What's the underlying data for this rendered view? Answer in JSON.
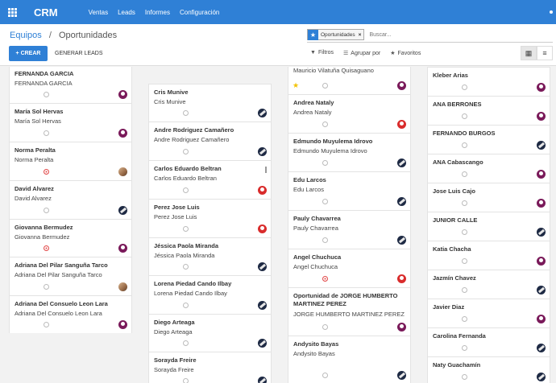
{
  "navbar": {
    "brand": "CRM",
    "menu": [
      "Ventas",
      "Leads",
      "Informes",
      "Configuración"
    ]
  },
  "breadcrumb": {
    "parent": "Equipos",
    "separator": "/",
    "current": "Oportunidades"
  },
  "buttons": {
    "create": "+ CREAR",
    "generate": "GENERAR LEADS"
  },
  "search": {
    "facet": "Oportunidades",
    "placeholder": "Buscar..."
  },
  "filters": {
    "filters": "Filtros",
    "group_by": "Agrupar por",
    "favorites": "Favoritos"
  },
  "columns": [
    {
      "cards": [
        {
          "title": "FERNANDA GARCIA",
          "sub": "FERNANDA GARCIA",
          "status": "grey",
          "avatar": "purple"
        },
        {
          "title": "María Sol Hervas",
          "sub": "María Sol Hervas",
          "status": "grey",
          "avatar": "purple"
        },
        {
          "title": "Norma Peralta",
          "sub": "Norma Peralta",
          "status": "red",
          "avatar": "photo"
        },
        {
          "title": "David Alvarez",
          "sub": "David Alvarez",
          "status": "grey",
          "avatar": "dark"
        },
        {
          "title": "Giovanna Bermudez",
          "sub": "Giovanna Bermudez",
          "status": "red",
          "avatar": "purple"
        },
        {
          "title": "Adriana Del Pilar Sanguña Tarco",
          "sub": "Adriana Del Pilar Sanguña Tarco",
          "status": "grey",
          "avatar": "photo"
        },
        {
          "title": "Adriana Del Consuelo Leon Lara",
          "sub": "Adriana Del Consuelo Leon Lara",
          "status": "grey",
          "avatar": "purple"
        }
      ]
    },
    {
      "cards": [
        {
          "title": "Cris Munive",
          "sub": "Cris Munive",
          "status": "grey",
          "avatar": "dark"
        },
        {
          "title": "Andre Rodriguez Camañero",
          "sub": "Andre Rodriguez Camañero",
          "status": "grey",
          "avatar": "dark"
        },
        {
          "title": "Carlos Eduardo Beltran",
          "sub": "Carlos Eduardo Beltran",
          "status": "grey",
          "avatar": "red"
        },
        {
          "title": "Perez Jose Luis",
          "sub": "Perez Jose Luis",
          "status": "grey",
          "avatar": "red"
        },
        {
          "title": "Jéssica Paola Miranda",
          "sub": "Jéssica Paola Miranda",
          "status": "grey",
          "avatar": "dark"
        },
        {
          "title": "Lorena Piedad Cando Ilbay",
          "sub": "Lorena Piedad Cando Ilbay",
          "status": "grey",
          "avatar": "dark"
        },
        {
          "title": "Diego Arteaga",
          "sub": "Diego Arteaga",
          "status": "grey",
          "avatar": "dark"
        },
        {
          "title": "Sorayda Freire",
          "sub": "Sorayda Freire",
          "status": "grey",
          "avatar": "dark"
        }
      ]
    },
    {
      "cards": [
        {
          "title": "",
          "sub": "Mauricio Vilatuña Quisaguano",
          "status": "star",
          "avatar": "purple"
        },
        {
          "title": "Andrea Nataly",
          "sub": "Andrea Nataly",
          "status": "grey",
          "avatar": "red"
        },
        {
          "title": "Edmundo Muyulema Idrovo",
          "sub": "Edmundo Muyulema Idrovo",
          "status": "grey",
          "avatar": "dark"
        },
        {
          "title": "Edu Larcos",
          "sub": "Edu Larcos",
          "status": "grey",
          "avatar": "dark"
        },
        {
          "title": "Pauly Chavarrea",
          "sub": "Pauly Chavarrea",
          "status": "grey",
          "avatar": "dark"
        },
        {
          "title": "Angel Chuchuca",
          "sub": "Angel Chuchuca",
          "status": "red",
          "avatar": "red"
        },
        {
          "title": "Oportunidad de JORGE HUMBERTO MARTINEZ PEREZ",
          "sub": "JORGE HUMBERTO MARTINEZ PEREZ",
          "status": "grey",
          "avatar": "purple"
        },
        {
          "title": "Andysito Bayas",
          "sub": "Andysito Bayas",
          "status": "grey",
          "avatar": "dark"
        }
      ]
    },
    {
      "cards": [
        {
          "title": "Kleber Arias",
          "status": "grey",
          "avatar": "purple"
        },
        {
          "title": "ANA BERRONES",
          "status": "grey",
          "avatar": "purple"
        },
        {
          "title": "FERNANDO BURGOS",
          "status": "grey",
          "avatar": "dark"
        },
        {
          "title": "ANA Cabascango",
          "status": "grey",
          "avatar": "purple"
        },
        {
          "title": "Jose Luis Cajo",
          "status": "grey",
          "avatar": "purple"
        },
        {
          "title": "JUNIOR CALLE",
          "status": "grey",
          "avatar": "dark"
        },
        {
          "title": "Katia Chacha",
          "status": "grey",
          "avatar": "purple"
        },
        {
          "title": "Jazmín Chavez",
          "status": "grey",
          "avatar": "dark"
        },
        {
          "title": "Javier Diaz",
          "status": "grey",
          "avatar": "purple"
        },
        {
          "title": "Carolina Fernanda",
          "status": "grey",
          "avatar": "dark"
        },
        {
          "title": "Naty Guachamín",
          "status": "grey",
          "avatar": "dark"
        }
      ]
    }
  ]
}
